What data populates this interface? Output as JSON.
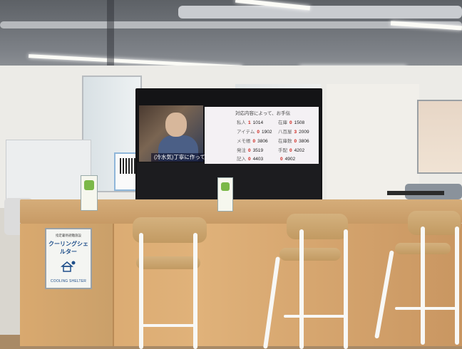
{
  "scene": {
    "description_colors": {
      "screen": "#141416",
      "counter": "#d7a56b",
      "wall": "#ecebe7"
    }
  },
  "screen": {
    "subtitle": "(冷水気)丁寧に作って行ったと",
    "header": "対応内容によって、お手伝",
    "rows_left": [
      {
        "label": "私人",
        "num": "1",
        "value": "1014"
      },
      {
        "label": "アイテム",
        "num": "0",
        "value": "1902"
      },
      {
        "label": "メモ帳",
        "num": "0",
        "value": "3806"
      },
      {
        "label": "発注",
        "num": "0",
        "value": "3519"
      },
      {
        "label": "記入",
        "num": "0",
        "value": "4403"
      }
    ],
    "rows_right": [
      {
        "label": "在庫",
        "num": "0",
        "value": "1508"
      },
      {
        "label": "八百屋",
        "num": "3",
        "value": "2009"
      },
      {
        "label": "在庫数",
        "num": "0",
        "value": "3806"
      },
      {
        "label": "手配",
        "num": "0",
        "value": "4202"
      },
      {
        "label": "",
        "num": "0",
        "value": "4902"
      }
    ]
  },
  "sign": {
    "line1": "指定暑熱避難施設",
    "line2": "クーリングシェルター",
    "line3": "COOLING SHELTER"
  }
}
